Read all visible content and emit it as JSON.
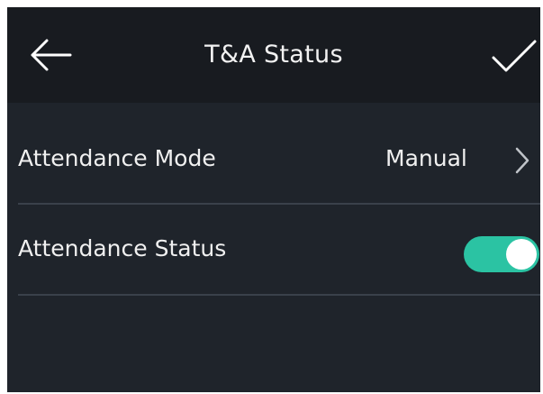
{
  "header": {
    "title": "T&A Status",
    "back_icon": "arrow-left-icon",
    "confirm_icon": "checkmark-icon"
  },
  "settings": [
    {
      "label": "Attendance Mode",
      "value": "Manual",
      "icon": "chevron-right-icon"
    },
    {
      "label": "Attendance Status",
      "toggle_on": true
    }
  ],
  "colors": {
    "header_bg": "#181b20",
    "body_bg": "#1f242b",
    "divider": "#3a414b",
    "toggle_on": "#2bc3a3",
    "text": "#f0f0f0"
  }
}
